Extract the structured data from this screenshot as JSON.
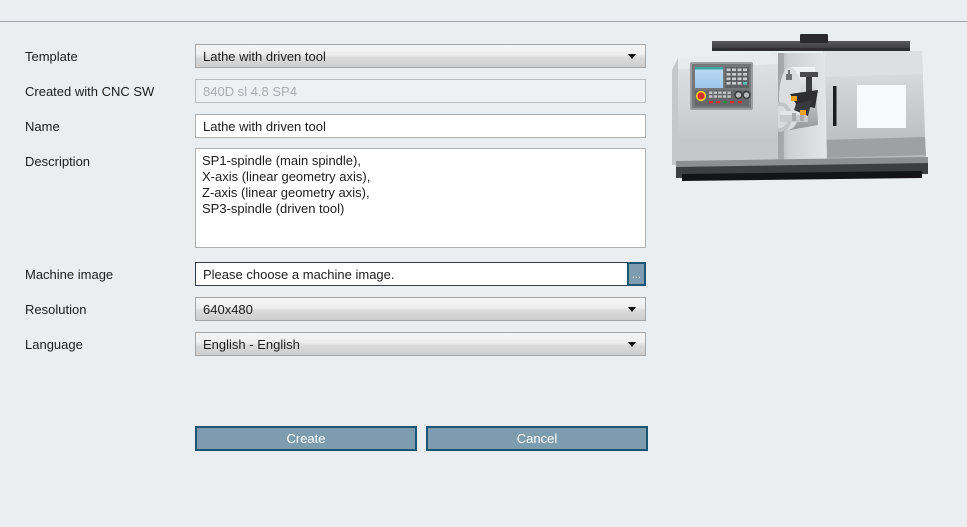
{
  "window": {
    "background_color": "#eaeef1",
    "accent_color": "#7d9cad",
    "accent_border_color": "#1a5673"
  },
  "form": {
    "fields": [
      {
        "label": "Template",
        "type": "dropdown",
        "value": "Lathe with driven tool"
      },
      {
        "label": "Created with CNC SW",
        "type": "readonly-text",
        "value": "840D sl 4.8 SP4"
      },
      {
        "label": "Name",
        "type": "text",
        "value": "Lathe with driven tool"
      },
      {
        "label": "Description",
        "type": "textarea",
        "lines": [
          "SP1-spindle (main spindle),",
          "X-axis (linear geometry axis),",
          "Z-axis (linear geometry axis),",
          "SP3-spindle (driven tool)"
        ]
      },
      {
        "label": "Machine image",
        "type": "file",
        "value": "Please choose a machine image.",
        "browse_label": "..."
      },
      {
        "label": "Resolution",
        "type": "dropdown",
        "value": "640x480"
      },
      {
        "label": "Language",
        "type": "dropdown",
        "value": "English - English"
      }
    ]
  },
  "actions": {
    "create_label": "Create",
    "cancel_label": "Cancel"
  },
  "preview": {
    "alt": "CNC lathe with driven tool machine illustration",
    "colors": {
      "body_light": "#d5d6d8",
      "body_mid": "#b9babc",
      "body_dark": "#8e8f91",
      "rail_dark": "#4a4a4c",
      "base_black": "#2b2b2d",
      "screen_blue": "#a8cff0",
      "estop_red": "#d32f2f",
      "tool_orange": "#f0a21e"
    }
  }
}
